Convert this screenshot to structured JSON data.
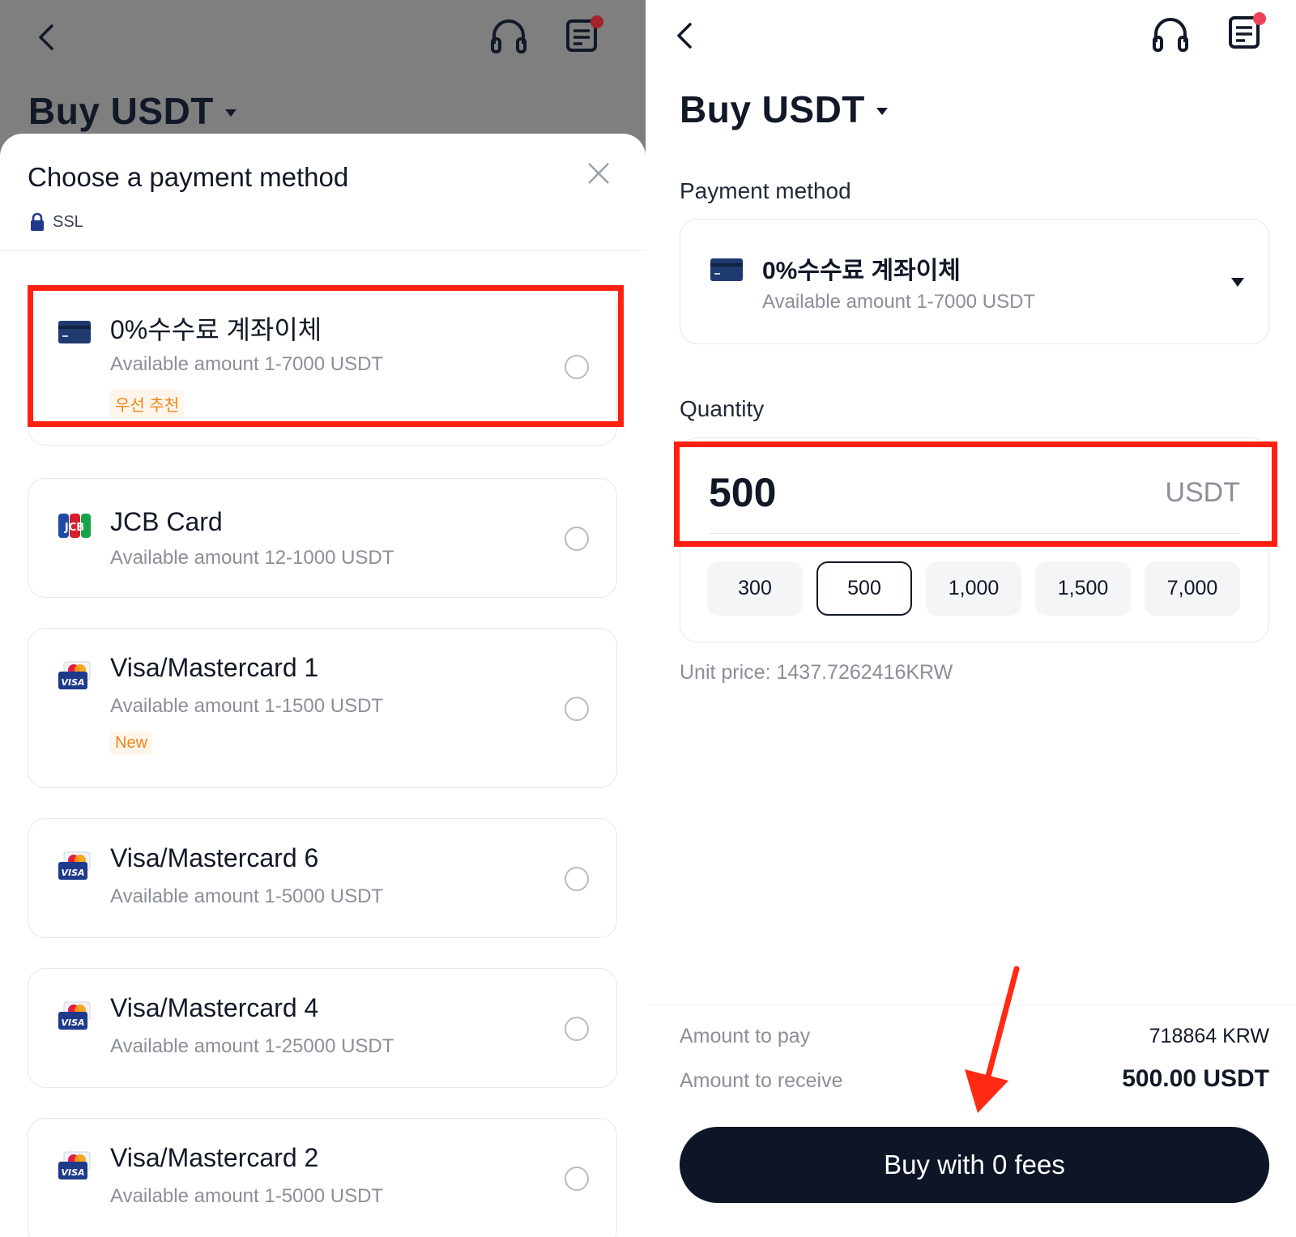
{
  "left": {
    "header": {
      "title": "Buy USDT"
    },
    "sheet": {
      "title": "Choose a payment method",
      "ssl_label": "SSL",
      "methods": [
        {
          "name": "0%수수료 계좌이체",
          "range": "Available amount 1-7000 USDT",
          "badge": "우선 추천",
          "icon": "bank-card-icon"
        },
        {
          "name": "JCB Card",
          "range": "Available amount 12-1000 USDT",
          "icon": "jcb-icon"
        },
        {
          "name": "Visa/Mastercard 1",
          "range": "Available amount 1-1500 USDT",
          "badge": "New",
          "icon": "visa-mastercard-icon"
        },
        {
          "name": "Visa/Mastercard 6",
          "range": "Available amount 1-5000 USDT",
          "icon": "visa-mastercard-icon"
        },
        {
          "name": "Visa/Mastercard 4",
          "range": "Available amount 1-25000 USDT",
          "icon": "visa-mastercard-icon"
        },
        {
          "name": "Visa/Mastercard 2",
          "range": "Available amount 1-5000 USDT",
          "icon": "visa-mastercard-icon"
        }
      ]
    }
  },
  "right": {
    "header": {
      "title": "Buy USDT"
    },
    "payment_label": "Payment method",
    "selected_method": {
      "name": "0%수수료 계좌이체",
      "range": "Available amount 1-7000 USDT"
    },
    "quantity_label": "Quantity",
    "quantity": {
      "value": "500",
      "unit": "USDT"
    },
    "presets": [
      "300",
      "500",
      "1,000",
      "1,500",
      "7,000"
    ],
    "selected_preset": "500",
    "unit_price": "Unit price: 1437.7262416KRW",
    "summary": {
      "pay_label": "Amount to pay",
      "pay_value": "718864 KRW",
      "receive_label": "Amount to receive",
      "receive_value": "500.00 USDT"
    },
    "buy_button": "Buy with 0 fees"
  },
  "colors": {
    "highlight": "#ff2010",
    "primary": "#0d1526",
    "badge": "#f08419",
    "overlay": "#7f7f7f"
  }
}
